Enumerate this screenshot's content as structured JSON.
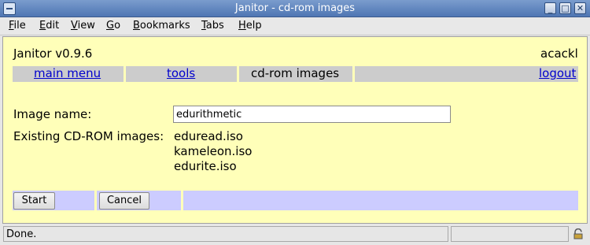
{
  "window": {
    "title": "Janitor - cd-rom images",
    "minimize": "_",
    "maximize": "□",
    "close": "✕"
  },
  "menu": [
    "File",
    "Edit",
    "View",
    "Go",
    "Bookmarks",
    "Tabs",
    "Help"
  ],
  "app": {
    "name": "Janitor v0.9.6",
    "user": "acackl"
  },
  "nav": {
    "main_menu": "main menu",
    "tools": "tools",
    "current": "cd-rom images",
    "logout": "logout"
  },
  "form": {
    "image_name_label": "Image name:",
    "image_name_value": "edurithmetic",
    "existing_label": "Existing CD-ROM images:",
    "existing": [
      "eduread.iso",
      "kameleon.iso",
      "edurite.iso"
    ]
  },
  "buttons": {
    "start": "Start",
    "cancel": "Cancel"
  },
  "status": {
    "text": "Done."
  }
}
